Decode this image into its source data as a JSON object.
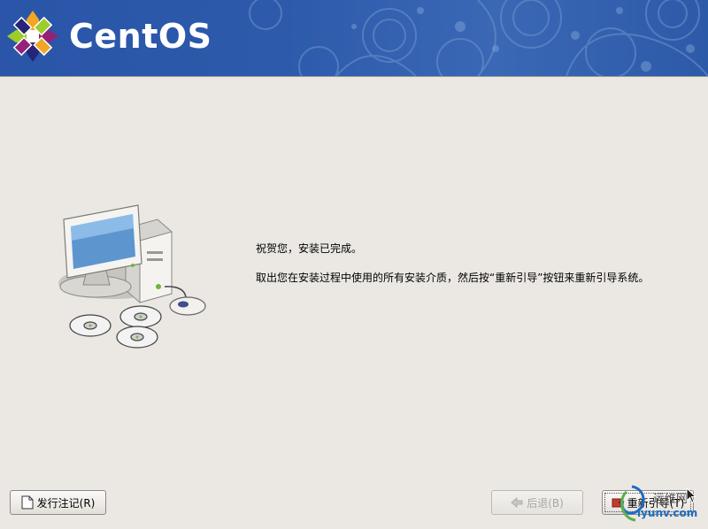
{
  "header": {
    "brand_name": "CentOS",
    "background_color": "#2d5aab",
    "logo_icon": "centos-logo-icon"
  },
  "main": {
    "illustration_icon": "computer-with-discs-icon",
    "message_line1": "祝贺您，安装已完成。",
    "message_line2": "取出您在安装过程中使用的所有安装介质，然后按“重新引导”按钮来重新引导系统。"
  },
  "buttons": {
    "release_notes_label": "发行注记(R)",
    "back_label": "后退(B)",
    "reboot_label": "重新引导(T)"
  },
  "watermark": {
    "top_text": "运维网",
    "bottom_text": "iyunv.com"
  }
}
